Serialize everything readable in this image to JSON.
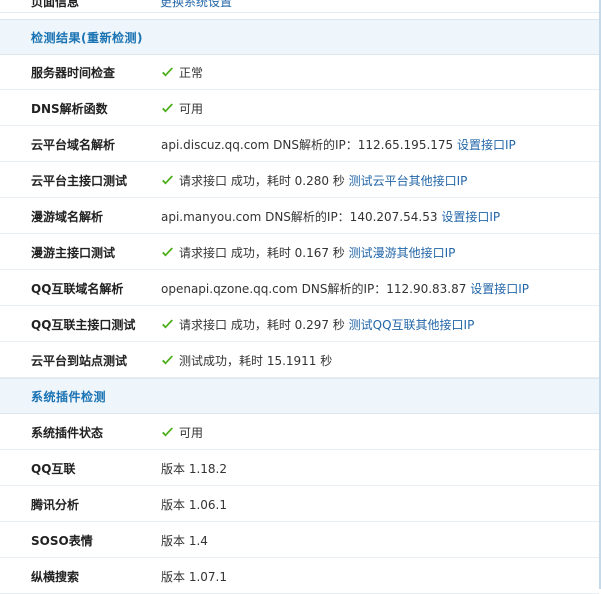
{
  "top_partial": {
    "label": "页面信息",
    "link": "更换系统设置"
  },
  "sections": [
    {
      "title": "检测结果(重新检测)"
    },
    {
      "title": "系统插件检测"
    }
  ],
  "rows": [
    {
      "label": "服务器时间检查",
      "check": true,
      "text": "正常",
      "link": ""
    },
    {
      "label": "DNS解析函数",
      "check": true,
      "text": "可用",
      "link": ""
    },
    {
      "label": "云平台域名解析",
      "check": false,
      "text": "api.discuz.qq.com DNS解析的IP：112.65.195.175",
      "link": "设置接口IP"
    },
    {
      "label": "云平台主接口测试",
      "check": true,
      "text": "请求接口 成功，耗时 0.280 秒",
      "link": "测试云平台其他接口IP"
    },
    {
      "label": "漫游域名解析",
      "check": false,
      "text": "api.manyou.com DNS解析的IP：140.207.54.53",
      "link": "设置接口IP"
    },
    {
      "label": "漫游主接口测试",
      "check": true,
      "text": "请求接口 成功，耗时 0.167 秒",
      "link": "测试漫游其他接口IP"
    },
    {
      "label": "QQ互联域名解析",
      "check": false,
      "text": "openapi.qzone.qq.com DNS解析的IP：112.90.83.87",
      "link": "设置接口IP"
    },
    {
      "label": "QQ互联主接口测试",
      "check": true,
      "text": "请求接口 成功，耗时 0.297 秒",
      "link": "测试QQ互联其他接口IP"
    },
    {
      "label": "云平台到站点测试",
      "check": true,
      "text": "测试成功，耗时 15.1911 秒",
      "link": ""
    }
  ],
  "plugin_rows": [
    {
      "label": "系统插件状态",
      "check": true,
      "text": "可用",
      "link": ""
    },
    {
      "label": "QQ互联",
      "check": false,
      "text": "版本 1.18.2",
      "link": ""
    },
    {
      "label": "腾讯分析",
      "check": false,
      "text": "版本 1.06.1",
      "link": ""
    },
    {
      "label": "SOSO表情",
      "check": false,
      "text": "版本 1.4",
      "link": ""
    },
    {
      "label": "纵横搜索",
      "check": false,
      "text": "版本 1.07.1",
      "link": ""
    }
  ],
  "icons": {
    "check": "check-icon"
  },
  "colors": {
    "check": "#4caf1a",
    "link": "#2366a8",
    "section_title": "#1a73b3",
    "section_bg": "#eef5fb"
  }
}
